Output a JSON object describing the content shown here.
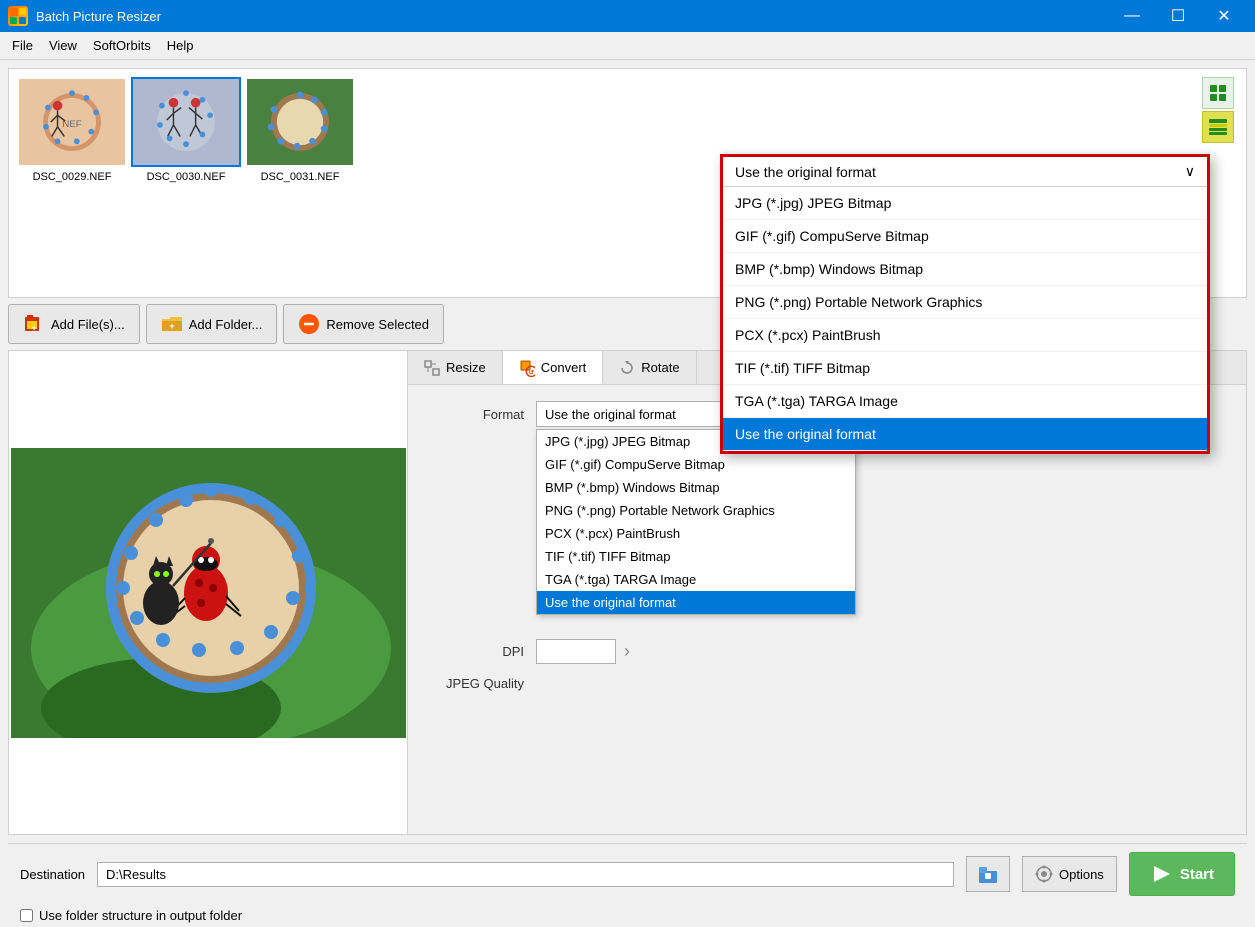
{
  "app": {
    "title": "Batch Picture Resizer",
    "icon_label": "BP"
  },
  "title_bar": {
    "minimize_label": "—",
    "maximize_label": "☐",
    "close_label": "✕"
  },
  "menu": {
    "items": [
      "File",
      "View",
      "SoftOrbits",
      "Help"
    ]
  },
  "images": [
    {
      "name": "DSC_0029.NEF",
      "selected": false
    },
    {
      "name": "DSC_0030.NEF",
      "selected": true
    },
    {
      "name": "DSC_0031.NEF",
      "selected": false
    }
  ],
  "toolbar": {
    "add_files_label": "Add File(s)...",
    "add_folder_label": "Add Folder...",
    "remove_selected_label": "Remove Selected"
  },
  "tabs": [
    {
      "id": "resize",
      "label": "Resize",
      "active": false
    },
    {
      "id": "convert",
      "label": "Convert",
      "active": true
    },
    {
      "id": "rotate",
      "label": "Rotate",
      "active": false
    }
  ],
  "convert_panel": {
    "format_label": "Format",
    "dpi_label": "DPI",
    "jpeg_quality_label": "JPEG Quality",
    "format_selected": "Use the original format",
    "dpi_value": "",
    "jpeg_quality_value": ""
  },
  "format_options": [
    {
      "label": "JPG (*.jpg) JPEG Bitmap",
      "selected": false
    },
    {
      "label": "GIF (*.gif) CompuServe Bitmap",
      "selected": false
    },
    {
      "label": "BMP (*.bmp) Windows Bitmap",
      "selected": false
    },
    {
      "label": "PNG (*.png) Portable Network Graphics",
      "selected": false
    },
    {
      "label": "PCX (*.pcx) PaintBrush",
      "selected": false
    },
    {
      "label": "TIF (*.tif) TIFF Bitmap",
      "selected": false
    },
    {
      "label": "TGA (*.tga) TARGA Image",
      "selected": false
    },
    {
      "label": "Use the original format",
      "selected": true
    }
  ],
  "large_dropdown": {
    "header_label": "Use the original format",
    "items": [
      {
        "label": "JPG (*.jpg) JPEG Bitmap",
        "selected": false
      },
      {
        "label": "GIF (*.gif) CompuServe Bitmap",
        "selected": false
      },
      {
        "label": "BMP (*.bmp) Windows Bitmap",
        "selected": false
      },
      {
        "label": "PNG (*.png) Portable Network Graphics",
        "selected": false
      },
      {
        "label": "PCX (*.pcx) PaintBrush",
        "selected": false
      },
      {
        "label": "TIF (*.tif) TIFF Bitmap",
        "selected": false
      },
      {
        "label": "TGA (*.tga) TARGA Image",
        "selected": false
      },
      {
        "label": "Use the original format",
        "selected": true
      }
    ]
  },
  "bottom_bar": {
    "destination_label": "Destination",
    "destination_value": "D:\\Results",
    "destination_placeholder": "D:\\Results",
    "folder_structure_label": "Use folder structure in output folder",
    "options_label": "Options",
    "start_label": "Start"
  }
}
